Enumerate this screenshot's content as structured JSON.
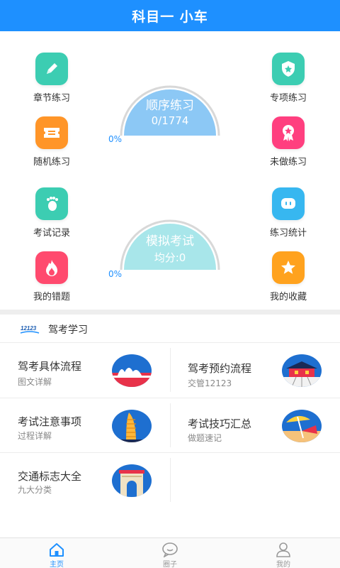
{
  "header": {
    "title": "科目一 小车"
  },
  "grid": {
    "chapter": "章节练习",
    "special": "专项练习",
    "random": "随机练习",
    "undone": "未做练习",
    "records": "考试记录",
    "stats": "练习统计",
    "mistakes": "我的错题",
    "favorites": "我的收藏"
  },
  "gauges": {
    "sequential": {
      "title": "顺序练习",
      "value": "0/1774",
      "percent": "0%"
    },
    "mock": {
      "title": "模拟考试",
      "value": "均分:0",
      "percent": "0%"
    }
  },
  "section": {
    "logo_text": "12123",
    "title": "驾考学习"
  },
  "cards": [
    {
      "title": "驾考具体流程",
      "subtitle": "图文详解",
      "icon": "opera-house-icon"
    },
    {
      "title": "驾考预约流程",
      "subtitle": "交管12123",
      "icon": "palace-icon"
    },
    {
      "title": "考试注意事项",
      "subtitle": "过程详解",
      "icon": "tower-icon"
    },
    {
      "title": "考试技巧汇总",
      "subtitle": "做题速记",
      "icon": "beach-umbrella-icon"
    },
    {
      "title": "交通标志大全",
      "subtitle": "九大分类",
      "icon": "arch-icon"
    }
  ],
  "tabs": [
    {
      "label": "主页",
      "icon": "home-icon",
      "active": true
    },
    {
      "label": "圈子",
      "icon": "chat-icon",
      "active": false
    },
    {
      "label": "我的",
      "icon": "user-icon",
      "active": false
    }
  ],
  "colors": {
    "primary": "#1e90ff",
    "gauge_sequential": "#8cc8f5",
    "gauge_mock": "#a8e6ea",
    "chapter": "#3ccdb2",
    "random": "#ff9528",
    "records": "#3ccdb2",
    "mistakes": "#ff4a6e",
    "special": "#3ccdb2",
    "undone": "#ff3f7f",
    "stats": "#37b7f0",
    "favorites": "#ffa21e"
  }
}
